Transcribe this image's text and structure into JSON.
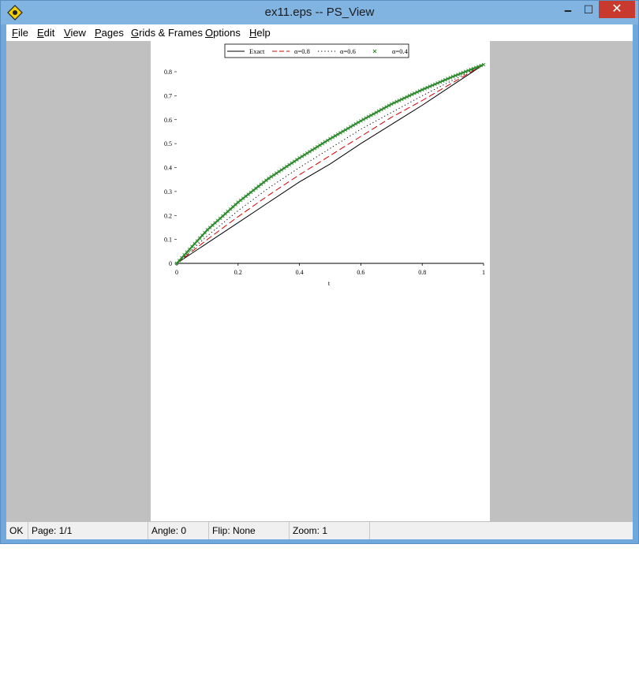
{
  "window": {
    "title": "ex11.eps -- PS_View",
    "minimize_glyph": "🗕",
    "maximize_glyph": "☐",
    "close_glyph": "✕"
  },
  "menu": {
    "items": [
      {
        "label": "File",
        "accel": "F",
        "rest": "ile"
      },
      {
        "label": "Edit",
        "accel": "E",
        "rest": "dit"
      },
      {
        "label": "View",
        "accel": "V",
        "rest": "iew"
      },
      {
        "label": "Pages",
        "accel": "P",
        "rest": "ages"
      },
      {
        "label": "Grids & Frames",
        "accel": "G",
        "rest": "rids & Frames"
      },
      {
        "label": "Options",
        "accel": "O",
        "rest": "ptions"
      },
      {
        "label": "Help",
        "accel": "H",
        "rest": "elp"
      }
    ]
  },
  "status": {
    "state": "OK",
    "page": "Page: 1/1",
    "angle": "Angle: 0",
    "flip": "Flip: None",
    "zoom": "Zoom: 1"
  },
  "chart_data": {
    "type": "line",
    "xlabel": "t",
    "ylabel": "",
    "xlim": [
      0,
      1
    ],
    "ylim": [
      0,
      0.8
    ],
    "xticks": [
      "0",
      "0.2",
      "0.4",
      "0.6",
      "0.8",
      "1"
    ],
    "yticks": [
      "0",
      "0.1",
      "0.2",
      "0.3",
      "0.4",
      "0.5",
      "0.6",
      "0.7",
      "0.8"
    ],
    "legend_position": "top",
    "series": [
      {
        "name": "Exact",
        "color": "#000000",
        "style": "solid",
        "x": [
          0,
          0.1,
          0.2,
          0.3,
          0.4,
          0.5,
          0.6,
          0.7,
          0.8,
          0.9,
          1.0
        ],
        "y": [
          0,
          0.085,
          0.17,
          0.255,
          0.34,
          0.415,
          0.5,
          0.58,
          0.66,
          0.745,
          0.83
        ]
      },
      {
        "name": "α=0.8",
        "color": "#d40000",
        "style": "dashed",
        "x": [
          0,
          0.1,
          0.2,
          0.3,
          0.4,
          0.5,
          0.6,
          0.7,
          0.8,
          0.9,
          1.0
        ],
        "y": [
          0,
          0.1,
          0.195,
          0.285,
          0.37,
          0.45,
          0.53,
          0.61,
          0.68,
          0.755,
          0.83
        ]
      },
      {
        "name": "α=0.6",
        "color": "#000000",
        "style": "dotted",
        "x": [
          0,
          0.1,
          0.2,
          0.3,
          0.4,
          0.5,
          0.6,
          0.7,
          0.8,
          0.9,
          1.0
        ],
        "y": [
          0,
          0.115,
          0.22,
          0.315,
          0.4,
          0.48,
          0.56,
          0.63,
          0.7,
          0.765,
          0.83
        ]
      },
      {
        "name": "α=0.4",
        "color": "#2e8b2e",
        "style": "marker-x",
        "x": [
          0,
          0.1,
          0.2,
          0.3,
          0.4,
          0.5,
          0.6,
          0.7,
          0.8,
          0.9,
          1.0
        ],
        "y": [
          0,
          0.14,
          0.255,
          0.355,
          0.44,
          0.52,
          0.595,
          0.665,
          0.725,
          0.78,
          0.83
        ]
      }
    ]
  }
}
